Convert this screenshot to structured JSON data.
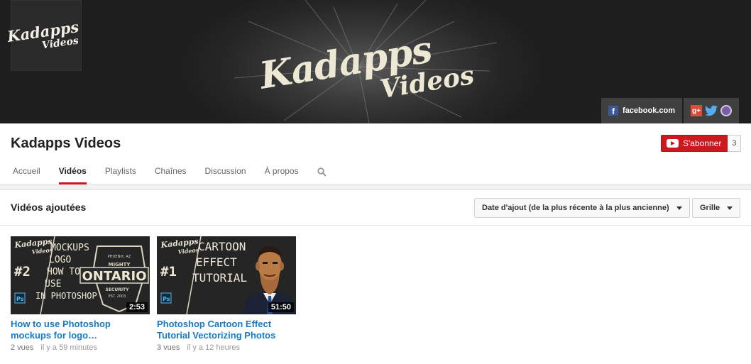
{
  "banner": {
    "avatar_line1": "Kadapps",
    "avatar_line2": "Videos",
    "brand_line1": "Kadapps",
    "brand_line2": "Videos",
    "link_facebook": "facebook.com"
  },
  "channel": {
    "title": "Kadapps Videos",
    "subscribe_label": "S'abonner",
    "subscriber_count": "3"
  },
  "tabs": [
    {
      "label": "Accueil"
    },
    {
      "label": "Vidéos",
      "active": true
    },
    {
      "label": "Playlists"
    },
    {
      "label": "Chaînes"
    },
    {
      "label": "Discussion"
    },
    {
      "label": "À propos"
    }
  ],
  "section": {
    "title": "Vidéos ajoutées",
    "sort_label": "Date d'ajout (de la plus récente à la plus ancienne)",
    "view_label": "Grille"
  },
  "videos": [
    {
      "title_line1": "How to use Photoshop",
      "title_line2": "mockups for logo…",
      "duration": "2:53",
      "views": "2 vues",
      "age": "il y a 59 minutes",
      "thumb": {
        "number": "#2",
        "logo1": "Kadapps",
        "logo2": "Videos",
        "words": [
          "MOCKUPS",
          "LOGO",
          "HOW TO",
          "USE",
          "IN PHOTOSHOP"
        ],
        "badge_top": "MIGHTY",
        "badge_main": "ONTARIO",
        "badge_bottom": "SECURITY",
        "badge_small": "PHOENIX, AZ",
        "badge_est": "EST. 2003",
        "ps": "Ps"
      }
    },
    {
      "title_line1": "Photoshop Cartoon Effect",
      "title_line2": "Tutorial Vectorizing Photos",
      "duration": "51:50",
      "views": "3 vues",
      "age": "il y a 12 heures",
      "thumb": {
        "number": "#1",
        "logo1": "Kadapps",
        "logo2": "Videos",
        "words": [
          "CARTOON",
          "EFFECT",
          "TUTORIAL"
        ],
        "ps": "Ps"
      }
    }
  ]
}
